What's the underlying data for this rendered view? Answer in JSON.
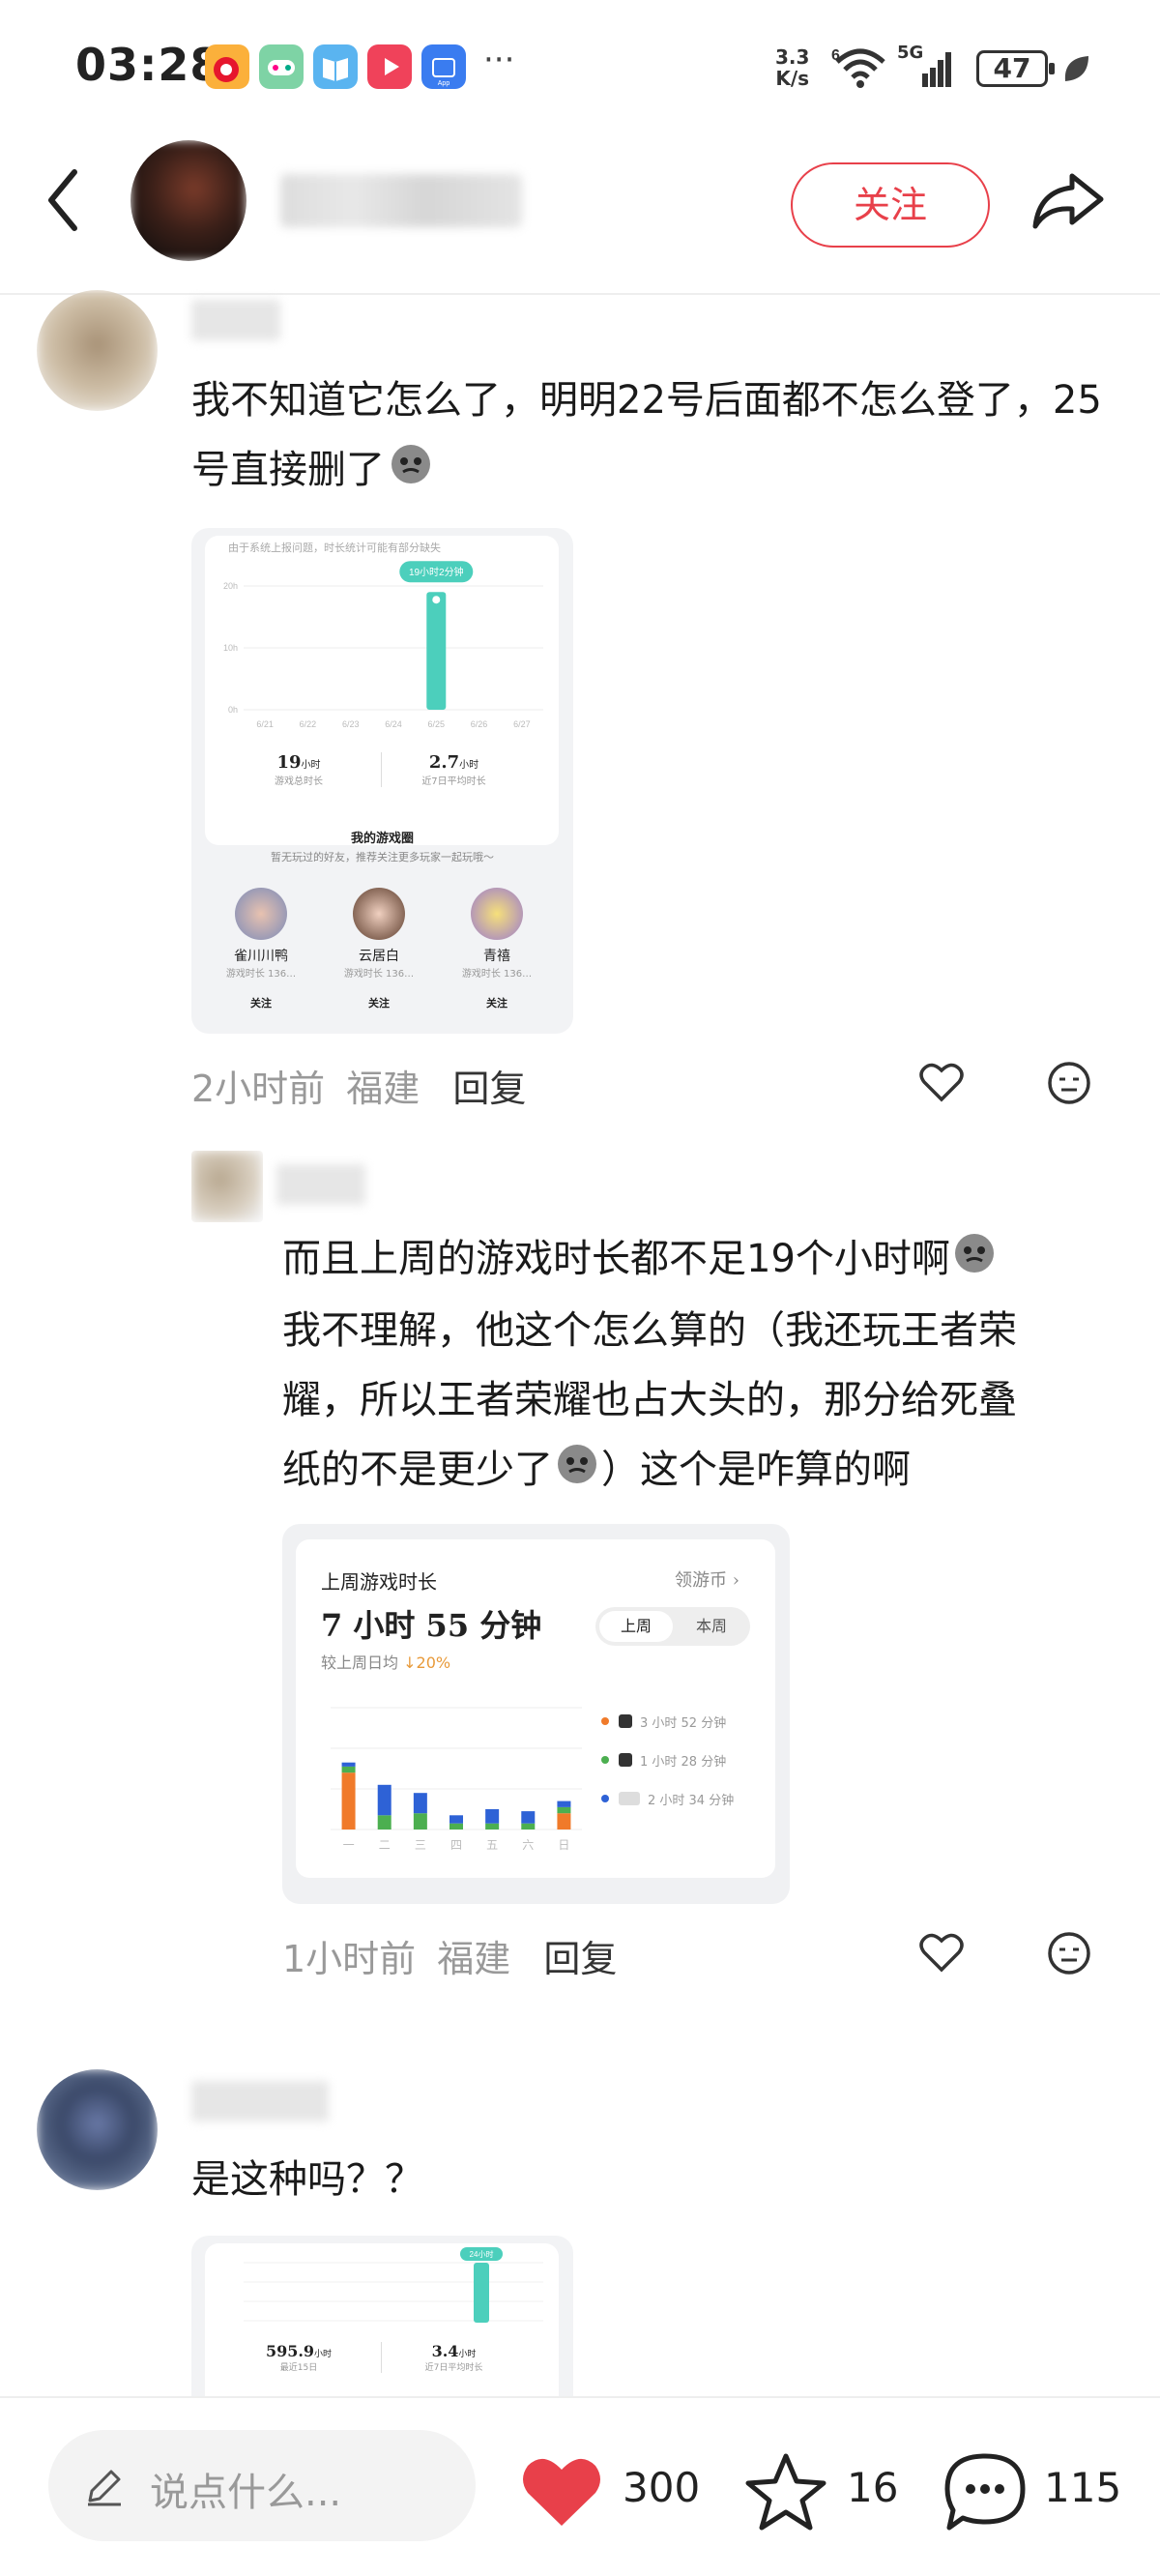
{
  "status_bar": {
    "time": "03:28",
    "more": "···",
    "net_speed_value": "3.3",
    "net_speed_unit": "K/s",
    "signal_label": "5G",
    "wifi_label": "6",
    "battery": "47"
  },
  "header": {
    "follow_label": "关注"
  },
  "comments": [
    {
      "text": "我不知道它怎么了，明明22号后面都不怎么登了，25号直接删了",
      "meta_time": "2小时前",
      "meta_location": "福建",
      "reply_label": "回复",
      "card": {
        "notice": "由于系统上报问题，时长统计可能有部分缺失",
        "tooltip": "19小时2分钟",
        "y_ticks": [
          "20h",
          "10h",
          "0h"
        ],
        "dates": [
          "6/21",
          "6/22",
          "6/23",
          "6/24",
          "6/25",
          "6/26",
          "6/27"
        ],
        "stat1_value": "19",
        "stat1_unit": "小时",
        "stat1_label": "游戏总时长",
        "stat2_value": "2.7",
        "stat2_unit": "小时",
        "stat2_label": "近7日平均时长",
        "circle_title": "我的游戏圈",
        "circle_sub": "暂无玩过的好友，推荐关注更多玩家一起玩哦～",
        "players": [
          {
            "name": "雀川川鸭",
            "desc": "游戏时长 136…",
            "btn": "关注"
          },
          {
            "name": "云居白",
            "desc": "游戏时长 136…",
            "btn": "关注"
          },
          {
            "name": "青禧",
            "desc": "游戏时长 136…",
            "btn": "关注"
          }
        ]
      }
    },
    {
      "text": "而且上周的游戏时长都不足19个小时啊 我不理解，他这个怎么算的（我还玩王者荣耀，所以王者荣耀也占大头的，那分给死叠纸的不是更少了）这个是咋算的啊",
      "lines": [
        "而且上周的游戏时长都不足19个小时啊",
        "我不理解，他这个怎么算的（我还玩王者荣",
        "耀，所以王者荣耀也占大头的，那分给死叠",
        "纸的不是更少了",
        "）这个是咋算的啊"
      ],
      "meta_time": "1小时前",
      "meta_location": "福建",
      "reply_label": "回复",
      "card": {
        "title": "上周游戏时长",
        "coins": "领游币",
        "total": "7 小时 55 分钟",
        "compare_label": "较上周日均",
        "compare_value": "↓20%",
        "tab_last": "上周",
        "tab_this": "本周",
        "legend": [
          {
            "label": "3 小时 52 分钟",
            "color": "#f07a2a"
          },
          {
            "label": "1 小时 28 分钟",
            "color": "#4caf50"
          },
          {
            "label": "2 小时 34 分钟",
            "color": "#2e62d6"
          }
        ],
        "days": [
          "一",
          "二",
          "三",
          "四",
          "五",
          "六",
          "日"
        ]
      }
    },
    {
      "text": "是这种吗？？",
      "card": {
        "tooltip": "24小时",
        "stat1_value": "595.9",
        "stat1_unit": "小时",
        "stat1_label": "最近15日",
        "stat2_value": "3.4",
        "stat2_unit": "小时",
        "stat2_label": "近7日平均时长"
      }
    }
  ],
  "chart_data": [
    {
      "type": "bar",
      "title": "",
      "categories": [
        "6/21",
        "6/22",
        "6/23",
        "6/24",
        "6/25",
        "6/26",
        "6/27"
      ],
      "values": [
        0,
        0,
        0,
        0,
        19.03,
        0,
        0
      ],
      "ylabel": "",
      "ylim": [
        0,
        20
      ]
    },
    {
      "type": "bar",
      "title": "上周游戏时长",
      "categories": [
        "一",
        "二",
        "三",
        "四",
        "五",
        "六",
        "日"
      ],
      "series": [
        {
          "name": "3 小时 52 分钟",
          "values": [
            1.4,
            0.0,
            0.0,
            0.0,
            0.0,
            0.0,
            0.4
          ]
        },
        {
          "name": "1 小时 28 分钟",
          "values": [
            0.15,
            0.35,
            0.4,
            0.15,
            0.15,
            0.15,
            0.15
          ]
        },
        {
          "name": "2 小时 34 分钟",
          "values": [
            0.1,
            0.75,
            0.5,
            0.2,
            0.35,
            0.3,
            0.15
          ]
        }
      ],
      "ylim": [
        0,
        3
      ]
    }
  ],
  "bottom_bar": {
    "input_placeholder": "说点什么...",
    "likes": "300",
    "stars": "16",
    "comments": "115"
  }
}
